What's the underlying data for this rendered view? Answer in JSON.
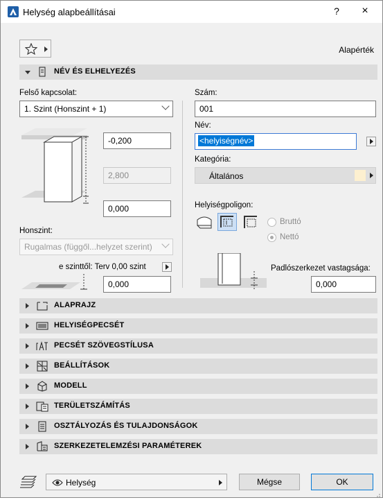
{
  "window": {
    "title": "Helység alapbeállításai",
    "help": "?",
    "close": "×"
  },
  "top": {
    "default_label": "Alapérték"
  },
  "name_section": {
    "header": "NÉV ÉS ELHELYEZÉS",
    "upper_link_label": "Felső kapcsolat:",
    "upper_link_value": "1. Szint (Honszint + 1)",
    "top_offset": "-0,200",
    "height": "2,800",
    "bottom_offset": "0,000",
    "home_story_label": "Honszint:",
    "home_story_value": "Rugalmas (függől...helyzet szerint)",
    "from_story_label": "e szinttől: Terv 0,00 szint",
    "from_story_value": "0,000",
    "number_label": "Szám:",
    "number_value": "001",
    "name_label": "Név:",
    "name_value": "<helyiségnév>",
    "category_label": "Kategória:",
    "category_value": "Általános",
    "category_color": "#fdf0d0",
    "polygon_label": "Helyiségpoligon:",
    "gross_label": "Bruttó",
    "net_label": "Nettó",
    "floor_thickness_label": "Padlószerkezet vastagsága:",
    "floor_thickness_value": "0,000"
  },
  "sections": [
    {
      "label": "ALAPRAJZ",
      "icon": "floor-plan-icon"
    },
    {
      "label": "HELYISÉGPECSÉT",
      "icon": "zone-stamp-icon"
    },
    {
      "label": "PECSÉT SZÖVEGSTÍLUSA",
      "icon": "text-style-icon"
    },
    {
      "label": "BEÁLLÍTÁSOK",
      "icon": "settings-grid-icon"
    },
    {
      "label": "MODELL",
      "icon": "model-cube-icon"
    },
    {
      "label": "TERÜLETSZÁMÍTÁS",
      "icon": "area-calc-icon"
    },
    {
      "label": "OSZTÁLYOZÁS ÉS TULAJDONSÁGOK",
      "icon": "classification-icon"
    },
    {
      "label": "SZERKEZETELEMZÉSI PARAMÉTEREK",
      "icon": "structural-icon"
    }
  ],
  "bottom": {
    "view_label": "Helység",
    "cancel": "Mégse",
    "ok": "OK"
  }
}
